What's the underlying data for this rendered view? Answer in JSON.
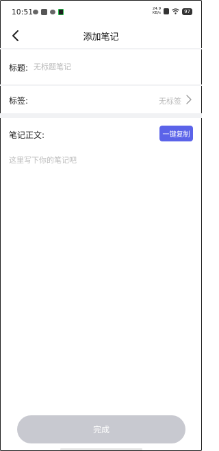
{
  "status_bar": {
    "time": "10:51",
    "net_speed_value": "24.9",
    "net_speed_unit": "KB/s",
    "battery": "97"
  },
  "nav": {
    "title": "添加笔记"
  },
  "title_field": {
    "label": "标题:",
    "placeholder": "无标题笔记"
  },
  "tag_field": {
    "label": "标签:",
    "value": "无标签"
  },
  "body_field": {
    "label": "笔记正文:",
    "copy_button": "一键复制",
    "placeholder": "这里写下你的笔记吧"
  },
  "footer": {
    "done_button": "完成"
  },
  "colors": {
    "accent": "#5b63e9",
    "done_disabled": "#c8c9d0"
  }
}
